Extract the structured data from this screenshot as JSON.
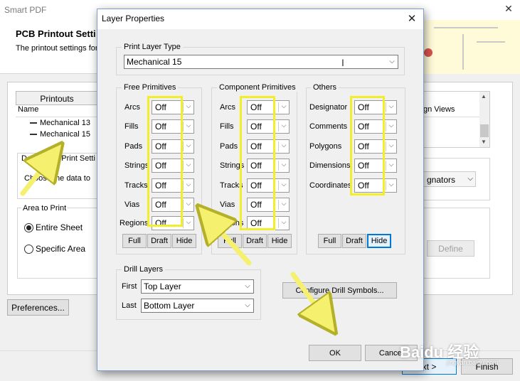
{
  "background_window": {
    "title": "Smart PDF",
    "close": "✕",
    "heading": "PCB Printout Setti",
    "subheading": "The printout settings for",
    "printouts_header": "Printouts",
    "name_column": "Name",
    "printouts": [
      "Mechanical 13",
      "Mechanical 15"
    ],
    "right_column_header": "gn Views",
    "designator_group_label": "Designator Print Setti",
    "choose_text": "Choose the data to",
    "area_group_label": "Area to Print",
    "entire_sheet": "Entire Sheet",
    "specific_area": "Specific Area",
    "designators_value": "gnators",
    "define_button": "Define",
    "preferences_button": "Preferences...",
    "next_button": "xt >",
    "finish_button": "Finish"
  },
  "dialog": {
    "title": "Layer Properties",
    "close": "✕",
    "print_layer_type": {
      "label": "Print Layer Type",
      "value": "Mechanical 15"
    },
    "free_primitives": {
      "label": "Free Primitives",
      "rows": [
        {
          "label": "Arcs",
          "value": "Off"
        },
        {
          "label": "Fills",
          "value": "Off"
        },
        {
          "label": "Pads",
          "value": "Off"
        },
        {
          "label": "Strings",
          "value": "Off"
        },
        {
          "label": "Tracks",
          "value": "Off"
        },
        {
          "label": "Vias",
          "value": "Off"
        },
        {
          "label": "Regions",
          "value": "Off"
        }
      ],
      "buttons": [
        "Full",
        "Draft",
        "Hide"
      ]
    },
    "component_primitives": {
      "label": "Component Primitives",
      "rows": [
        {
          "label": "Arcs",
          "value": "Off"
        },
        {
          "label": "Fills",
          "value": "Off"
        },
        {
          "label": "Pads",
          "value": "Off"
        },
        {
          "label": "Strings",
          "value": "Off"
        },
        {
          "label": "Tracks",
          "value": "Off"
        },
        {
          "label": "Vias",
          "value": "Off"
        },
        {
          "label": "Regions",
          "value": "Off"
        }
      ],
      "buttons": [
        "Full",
        "Draft",
        "Hide"
      ]
    },
    "others": {
      "label": "Others",
      "rows": [
        {
          "label": "Designator",
          "value": "Off"
        },
        {
          "label": "Comments",
          "value": "Off"
        },
        {
          "label": "Polygons",
          "value": "Off"
        },
        {
          "label": "Dimensions",
          "value": "Off"
        },
        {
          "label": "Coordinates",
          "value": "Off"
        }
      ],
      "buttons": [
        "Full",
        "Draft",
        "Hide"
      ]
    },
    "drill_layers": {
      "label": "Drill Layers",
      "first_label": "First",
      "first_value": "Top Layer",
      "last_label": "Last",
      "last_value": "Bottom Layer"
    },
    "configure_drill_button": "Configure Drill Symbols...",
    "ok_button": "OK",
    "cancel_button": "Cancel"
  },
  "colors": {
    "highlight": "#f2ee2a",
    "focus_border": "#0078d7",
    "annotation_arrow": "#f5f06e"
  },
  "watermark": {
    "text": "Baidu 经验",
    "sub": "jingyan.baidu.com"
  }
}
